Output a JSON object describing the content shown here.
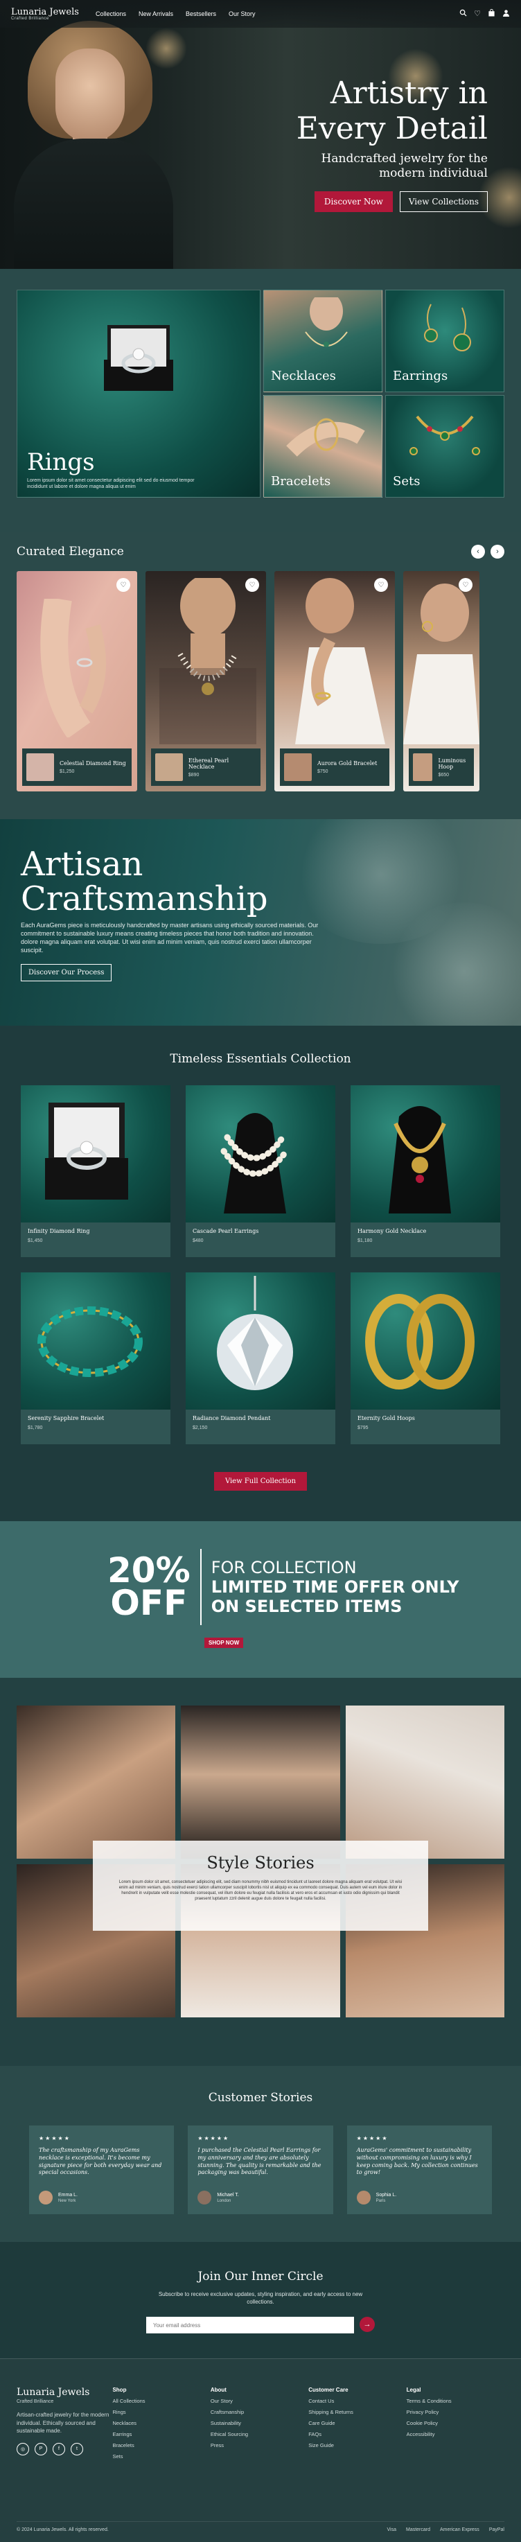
{
  "brand": {
    "name": "Lunaria Jewels",
    "tagline": "Crafted Brilliance"
  },
  "nav": {
    "links": [
      "Collections",
      "New Arrivals",
      "Bestsellers",
      "Our Story"
    ]
  },
  "hero": {
    "title_line1": "Artistry in",
    "title_line2": "Every Detail",
    "subtitle_line1": "Handcrafted jewelry for the",
    "subtitle_line2": "modern individual",
    "primary_button": "Discover Now",
    "secondary_button": "View Collections"
  },
  "categories": {
    "rings": {
      "label": "Rings",
      "desc": "Lorem ipsum dolor sit amet consectetur adipiscing elit sed do eiusmod tempor incididunt ut labore et dolore magna aliqua ut enim"
    },
    "necklaces": "Necklaces",
    "earrings": "Earrings",
    "bracelets": "Bracelets",
    "sets": "Sets"
  },
  "curated": {
    "title": "Curated Elegance",
    "items": [
      {
        "name": "Celestial Diamond Ring",
        "price": "$1,250"
      },
      {
        "name": "Ethereal Pearl Necklace",
        "price": "$890"
      },
      {
        "name": "Aurora Gold Bracelet",
        "price": "$750"
      },
      {
        "name": "Luminous Hoop",
        "price": "$650"
      }
    ]
  },
  "artisan": {
    "title_line1": "Artisan",
    "title_line2": "Craftsmanship",
    "body": "Each AuraGems piece is meticulously handcrafted by master artisans using ethically sourced materials. Our commitment to sustainable luxury means creating timeless pieces that honor both tradition and innovation. dolore magna aliquam erat volutpat. Ut wisi enim ad minim veniam, quis nostrud exerci tation ullamcorper suscipit.",
    "button": "Discover Our Process"
  },
  "essentials": {
    "title": "Timeless Essentials Collection",
    "items": [
      {
        "name": "Infinity Diamond Ring",
        "price": "$1,450"
      },
      {
        "name": "Cascade Pearl Earrings",
        "price": "$480"
      },
      {
        "name": "Harmony Gold Necklace",
        "price": "$1,180"
      },
      {
        "name": "Serenity Sapphire Bracelet",
        "price": "$1,780"
      },
      {
        "name": "Radiance Diamond Pendant",
        "price": "$2,150"
      },
      {
        "name": "Eternity Gold Hoops",
        "price": "$795"
      }
    ],
    "button": "View Full Collection"
  },
  "promo": {
    "percent": "20%",
    "off": "OFF",
    "line1": "FOR COLLECTION",
    "line2": "LIMITED TIME OFFER ONLY",
    "line3": "ON SELECTED ITEMS",
    "button": "SHOP NOW"
  },
  "stories": {
    "title": "Style Stories",
    "desc": "Lorem ipsum dolor sit amet, consectetuer adipiscing elit, sed diam nonummy nibh euismod tincidunt ut laoreet dolore magna aliquam erat volutpat. Ut wisi enim ad minim veniam, quis nostrud exerci tation ullamcorper suscipit lobortis nisl ut aliquip ex ea commodo consequat. Duis autem vel eum iriure dolor in hendrerit in vulputate velit esse molestie consequat, vel illum dolore eu feugiat nulla facilisis at vero eros et accumsan et iusto odio dignissim qui blandit praesent luptatum zzril delenit augue duis dolore te feugait nulla facilisi."
  },
  "testimonials": {
    "title": "Customer Stories",
    "items": [
      {
        "stars": "★★★★★",
        "quote": "The craftsmanship of my AuraGems necklace is exceptional. It's become my signature piece for both everyday wear and special occasions.",
        "name": "Emma L.",
        "location": "New York"
      },
      {
        "stars": "★★★★★",
        "quote": "I purchased the Celestial Pearl Earrings for my anniversary and they are absolutely stunning. The quality is remarkable and the packaging was beautiful.",
        "name": "Michael T.",
        "location": "London"
      },
      {
        "stars": "★★★★★",
        "quote": "AuraGems' commitment to sustainability without compromising on luxury is why I keep coming back. My collection continues to grow!",
        "name": "Sophia L.",
        "location": "Paris"
      }
    ]
  },
  "newsletter": {
    "title": "Join Our Inner Circle",
    "desc_line1": "Subscribe to receive exclusive updates, styling inspiration, and early access to new",
    "desc_line2": "collections.",
    "placeholder": "Your email address",
    "button_icon": "arrow-right-icon"
  },
  "footer": {
    "brand": "Lunaria Jewels",
    "tagline": "Crafted Brilliance",
    "desc": "Artisan-crafted jewelry for the modern individual. Ethically sourced and sustainable made.",
    "socials": [
      "instagram-icon",
      "pinterest-icon",
      "facebook-icon",
      "twitter-icon"
    ],
    "columns": [
      {
        "heading": "Shop",
        "items": [
          "All Collections",
          "Rings",
          "Necklaces",
          "Earrings",
          "Bracelets",
          "Sets"
        ]
      },
      {
        "heading": "About",
        "items": [
          "Our Story",
          "Craftsmanship",
          "Sustainability",
          "Ethical Sourcing",
          "Press"
        ]
      },
      {
        "heading": "Customer Care",
        "items": [
          "Contact Us",
          "Shipping & Returns",
          "Care Guide",
          "FAQs",
          "Size Guide"
        ]
      },
      {
        "heading": "Legal",
        "items": [
          "Terms & Conditions",
          "Privacy Policy",
          "Cookie Policy",
          "Accessibility"
        ]
      }
    ],
    "copyright": "© 2024 Lunaria Jewels. All rights reserved.",
    "payments": [
      "Visa",
      "Mastercard",
      "American Express",
      "PayPal"
    ]
  },
  "colors": {
    "primary_bg": "#1f3b3d",
    "accent": "#b2183a",
    "panel": "#2b4a4a"
  }
}
